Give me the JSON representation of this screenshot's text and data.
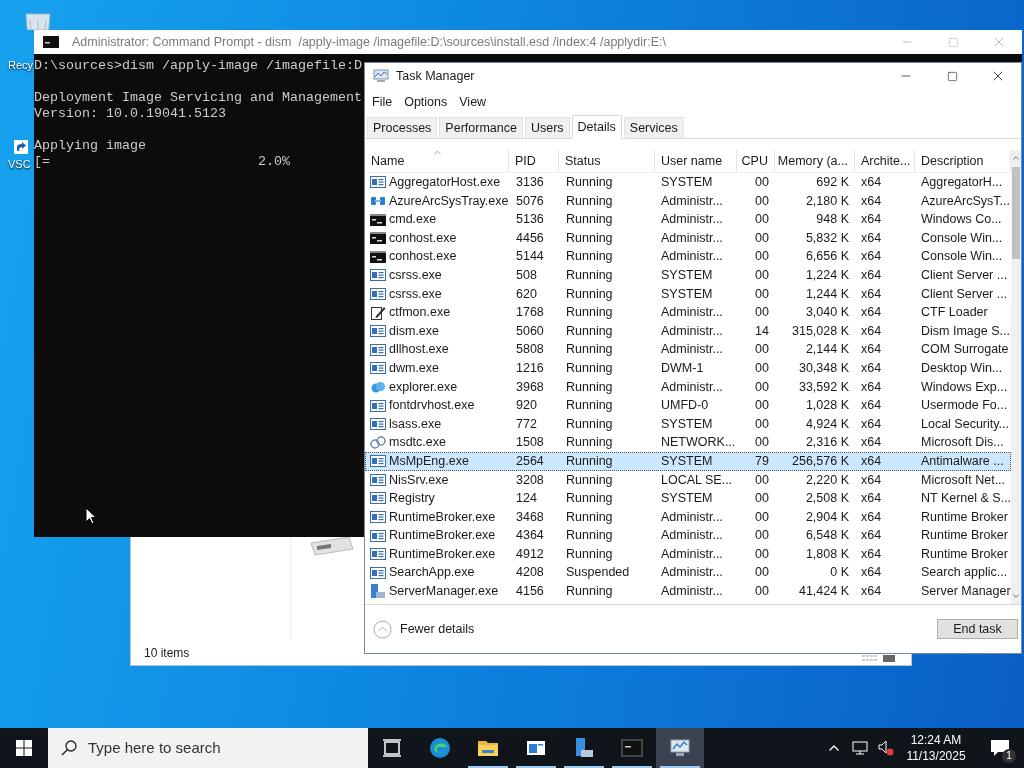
{
  "desktop": {
    "icons": [
      {
        "kind": "recycle",
        "label": "Recy"
      },
      {
        "kind": "shortcut",
        "label": "VSC"
      }
    ]
  },
  "explorer": {
    "status": "10 items"
  },
  "console_window": {
    "title": "Administrator: Command Prompt - dism  /apply-image /imagefile:D:\\sources\\install.esd /index:4 /applydir:E:\\",
    "paragraphs": [
      [
        "D:\\sources>dism /apply-image /imagefile:D"
      ],
      [
        "Deployment Image Servicing and Management",
        "Version: 10.0.19041.5123"
      ],
      [
        "Applying image",
        "[=                          2.0%"
      ]
    ]
  },
  "task_manager": {
    "title": "Task Manager",
    "menu": [
      "File",
      "Options",
      "View"
    ],
    "tabs": [
      {
        "label": "Processes",
        "selected": false
      },
      {
        "label": "Performance",
        "selected": false
      },
      {
        "label": "Users",
        "selected": false
      },
      {
        "label": "Details",
        "selected": true
      },
      {
        "label": "Services",
        "selected": false
      }
    ],
    "table": {
      "columns": [
        "Name",
        "PID",
        "Status",
        "User name",
        "CPU",
        "Memory (a...",
        "Archite...",
        "Description"
      ],
      "rows": [
        {
          "kind": "app",
          "name": "AggregatorHost.exe",
          "pid": "3136",
          "status": "Running",
          "user": "SYSTEM",
          "cpu": "00",
          "memory": "692 K",
          "arch": "x64",
          "description": "AggregatorH...",
          "selected": false
        },
        {
          "kind": "tray",
          "name": "AzureArcSysTray.exe",
          "pid": "5076",
          "status": "Running",
          "user": "Administr...",
          "cpu": "00",
          "memory": "2,180 K",
          "arch": "x64",
          "description": "AzureArcSysT...",
          "selected": false
        },
        {
          "kind": "console",
          "name": "cmd.exe",
          "pid": "5136",
          "status": "Running",
          "user": "Administr...",
          "cpu": "00",
          "memory": "948 K",
          "arch": "x64",
          "description": "Windows Co...",
          "selected": false
        },
        {
          "kind": "console",
          "name": "conhost.exe",
          "pid": "4456",
          "status": "Running",
          "user": "Administr...",
          "cpu": "00",
          "memory": "5,832 K",
          "arch": "x64",
          "description": "Console Win...",
          "selected": false
        },
        {
          "kind": "console",
          "name": "conhost.exe",
          "pid": "5144",
          "status": "Running",
          "user": "Administr...",
          "cpu": "00",
          "memory": "6,656 K",
          "arch": "x64",
          "description": "Console Win...",
          "selected": false
        },
        {
          "kind": "app",
          "name": "csrss.exe",
          "pid": "508",
          "status": "Running",
          "user": "SYSTEM",
          "cpu": "00",
          "memory": "1,224 K",
          "arch": "x64",
          "description": "Client Server ...",
          "selected": false
        },
        {
          "kind": "app",
          "name": "csrss.exe",
          "pid": "620",
          "status": "Running",
          "user": "SYSTEM",
          "cpu": "00",
          "memory": "1,244 K",
          "arch": "x64",
          "description": "Client Server ...",
          "selected": false
        },
        {
          "kind": "pen",
          "name": "ctfmon.exe",
          "pid": "1768",
          "status": "Running",
          "user": "Administr...",
          "cpu": "00",
          "memory": "3,040 K",
          "arch": "x64",
          "description": "CTF Loader",
          "selected": false
        },
        {
          "kind": "app",
          "name": "dism.exe",
          "pid": "5060",
          "status": "Running",
          "user": "Administr...",
          "cpu": "14",
          "memory": "315,028 K",
          "arch": "x64",
          "description": "Dism Image S...",
          "selected": false
        },
        {
          "kind": "app",
          "name": "dllhost.exe",
          "pid": "5808",
          "status": "Running",
          "user": "Administr...",
          "cpu": "00",
          "memory": "2,144 K",
          "arch": "x64",
          "description": "COM Surrogate",
          "selected": false
        },
        {
          "kind": "app",
          "name": "dwm.exe",
          "pid": "1216",
          "status": "Running",
          "user": "DWM-1",
          "cpu": "00",
          "memory": "30,348 K",
          "arch": "x64",
          "description": "Desktop Win...",
          "selected": false
        },
        {
          "kind": "shell",
          "name": "explorer.exe",
          "pid": "3968",
          "status": "Running",
          "user": "Administr...",
          "cpu": "00",
          "memory": "33,592 K",
          "arch": "x64",
          "description": "Windows Exp...",
          "selected": false
        },
        {
          "kind": "app",
          "name": "fontdrvhost.exe",
          "pid": "920",
          "status": "Running",
          "user": "UMFD-0",
          "cpu": "00",
          "memory": "1,028 K",
          "arch": "x64",
          "description": "Usermode Fo...",
          "selected": false
        },
        {
          "kind": "app",
          "name": "lsass.exe",
          "pid": "772",
          "status": "Running",
          "user": "SYSTEM",
          "cpu": "00",
          "memory": "4,924 K",
          "arch": "x64",
          "description": "Local Security...",
          "selected": false
        },
        {
          "kind": "network",
          "name": "msdtc.exe",
          "pid": "1508",
          "status": "Running",
          "user": "NETWORK...",
          "cpu": "00",
          "memory": "2,316 K",
          "arch": "x64",
          "description": "Microsoft Dis...",
          "selected": false
        },
        {
          "kind": "app",
          "name": "MsMpEng.exe",
          "pid": "2564",
          "status": "Running",
          "user": "SYSTEM",
          "cpu": "79",
          "memory": "256,576 K",
          "arch": "x64",
          "description": "Antimalware ...",
          "selected": true
        },
        {
          "kind": "app",
          "name": "NisSrv.exe",
          "pid": "3208",
          "status": "Running",
          "user": "LOCAL SE...",
          "cpu": "00",
          "memory": "2,220 K",
          "arch": "x64",
          "description": "Microsoft Net...",
          "selected": false
        },
        {
          "kind": "app",
          "name": "Registry",
          "pid": "124",
          "status": "Running",
          "user": "SYSTEM",
          "cpu": "00",
          "memory": "2,508 K",
          "arch": "x64",
          "description": "NT Kernel & S...",
          "selected": false
        },
        {
          "kind": "app",
          "name": "RuntimeBroker.exe",
          "pid": "3468",
          "status": "Running",
          "user": "Administr...",
          "cpu": "00",
          "memory": "2,904 K",
          "arch": "x64",
          "description": "Runtime Broker",
          "selected": false
        },
        {
          "kind": "app",
          "name": "RuntimeBroker.exe",
          "pid": "4364",
          "status": "Running",
          "user": "Administr...",
          "cpu": "00",
          "memory": "6,548 K",
          "arch": "x64",
          "description": "Runtime Broker",
          "selected": false
        },
        {
          "kind": "app",
          "name": "RuntimeBroker.exe",
          "pid": "4912",
          "status": "Running",
          "user": "Administr...",
          "cpu": "00",
          "memory": "1,808 K",
          "arch": "x64",
          "description": "Runtime Broker",
          "selected": false
        },
        {
          "kind": "app",
          "name": "SearchApp.exe",
          "pid": "4208",
          "status": "Suspended",
          "user": "Administr...",
          "cpu": "00",
          "memory": "0 K",
          "arch": "x64",
          "description": "Search applic...",
          "selected": false
        },
        {
          "kind": "server",
          "name": "ServerManager.exe",
          "pid": "4156",
          "status": "Running",
          "user": "Administr...",
          "cpu": "00",
          "memory": "41,424 K",
          "arch": "x64",
          "description": "Server Manager",
          "selected": false
        }
      ]
    },
    "fewer_details": "Fewer details",
    "end_task": "End task"
  },
  "taskbar": {
    "search_placeholder": "Type here to search",
    "apps": [
      {
        "kind": "taskview",
        "running": false,
        "selected": false
      },
      {
        "kind": "edge",
        "running": false,
        "selected": false
      },
      {
        "kind": "folder",
        "running": true,
        "selected": false
      },
      {
        "kind": "window",
        "running": true,
        "selected": false
      },
      {
        "kind": "server",
        "running": true,
        "selected": false
      },
      {
        "kind": "console",
        "running": true,
        "selected": false
      },
      {
        "kind": "taskmgr",
        "running": true,
        "selected": true
      }
    ],
    "time": "12:24 AM",
    "date": "11/13/2025",
    "notification_count": "1"
  }
}
